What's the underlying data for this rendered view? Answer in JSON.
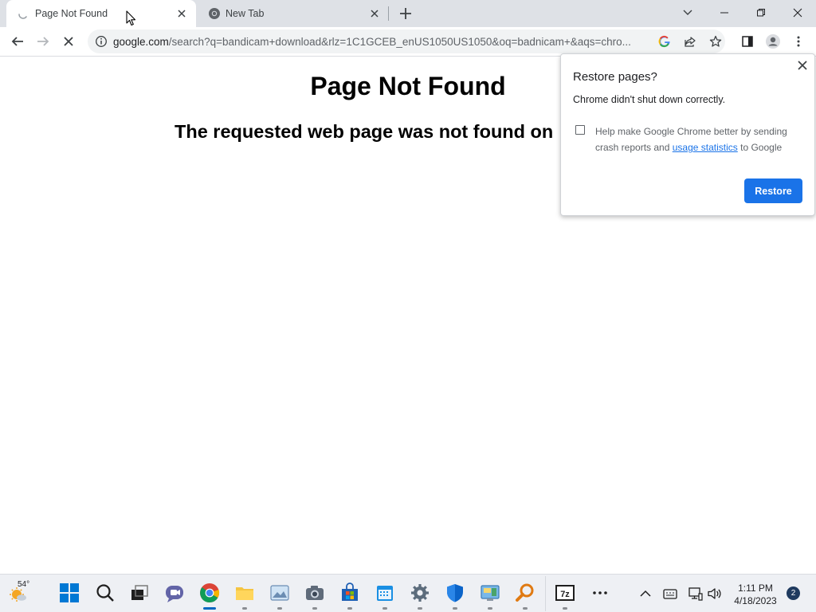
{
  "browser": {
    "tabs": [
      {
        "title": "Page Not Found",
        "active": true,
        "loading": true
      },
      {
        "title": "New Tab",
        "active": false
      }
    ],
    "address_bar": {
      "url_host": "google.com",
      "url_rest": "/search?q=bandicam+download&rlz=1C1GCEB_enUS1050US1050&oq=badnicam+&aqs=chro..."
    }
  },
  "page": {
    "heading": "Page Not Found",
    "message": "The requested web page was not found on"
  },
  "restore_bubble": {
    "title": "Restore pages?",
    "message": "Chrome didn't shut down correctly.",
    "checkbox_text_before": "Help make Google Chrome better by sending crash reports and",
    "checkbox_link": "usage statistics",
    "checkbox_text_after": "to Google",
    "checkbox_checked": false,
    "restore_button": "Restore"
  },
  "taskbar": {
    "weather_temp": "54°",
    "clock_time": "1:11 PM",
    "clock_date": "4/18/2023",
    "notification_count": "2"
  },
  "colors": {
    "accent": "#1a73e8",
    "tabstrip": "#dee1e6",
    "taskbar": "#eef0f4"
  }
}
